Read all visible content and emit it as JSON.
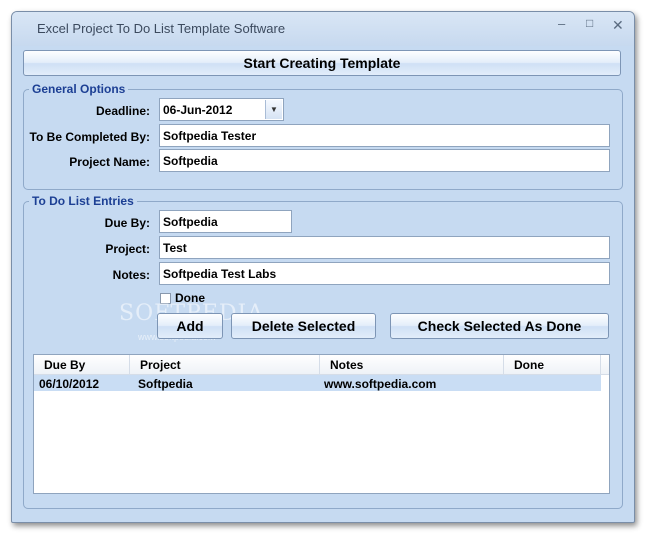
{
  "window": {
    "title": "Excel Project To Do List Template Software",
    "controls": {
      "minimize": "–",
      "maximize": "□",
      "close": "✕"
    }
  },
  "toolbar": {
    "start_label": "Start Creating Template"
  },
  "general_options": {
    "legend": "General Options",
    "deadline_label": "Deadline:",
    "deadline_value": "06-Jun-2012",
    "completed_by_label": "To Be Completed By:",
    "completed_by_value": "Softpedia Tester",
    "project_name_label": "Project Name:",
    "project_name_value": "Softpedia"
  },
  "entries": {
    "legend": "To Do List Entries",
    "due_by_label": "Due By:",
    "due_by_value": "Softpedia",
    "project_label": "Project:",
    "project_value": "Test",
    "notes_label": "Notes:",
    "notes_value": "Softpedia Test Labs",
    "done_label": "Done",
    "done_checked": false,
    "add_label": "Add",
    "delete_label": "Delete Selected",
    "check_done_label": "Check Selected As Done"
  },
  "watermark": {
    "text": "SOFTPEDIA",
    "sub": "www.softpedia.com"
  },
  "table": {
    "columns": [
      "Due By",
      "Project",
      "Notes",
      "Done"
    ],
    "rows": [
      {
        "due_by": "06/10/2012",
        "project": "Softpedia",
        "notes": "www.softpedia.com",
        "done": ""
      }
    ]
  },
  "colors": {
    "window_bg": "#c6daf1",
    "legend_text": "#1c3f94",
    "selected_row": "#c9ddf4"
  },
  "icons": {
    "dropdown": "chevron-down-icon"
  }
}
